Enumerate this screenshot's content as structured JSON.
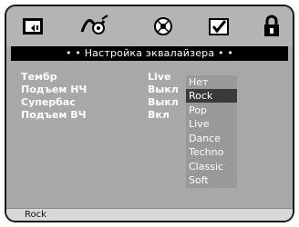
{
  "title": "• • Настройка эквалайзера • •",
  "toolbar": {
    "icons": [
      "monitor-speaker-icon",
      "audio-wave-icon",
      "disc-icon",
      "checkbox-icon",
      "lock-icon"
    ]
  },
  "settings": [
    {
      "label": "Тембр",
      "value": "Live"
    },
    {
      "label": "Подъем НЧ",
      "value": "Выкл"
    },
    {
      "label": "Супербас",
      "value": "Выкл"
    },
    {
      "label": "Подъем ВЧ",
      "value": "Вкл"
    }
  ],
  "options": [
    "Нет",
    "Rock",
    "Pop",
    "Live",
    "Dance",
    "Techno",
    "Classic",
    "Soft"
  ],
  "selected_option": "Rock",
  "status": {
    "text": "Rock"
  },
  "colors": {
    "background": "#a8a8a8",
    "title_bar": "#000000",
    "highlight": "#3a3a3a"
  }
}
